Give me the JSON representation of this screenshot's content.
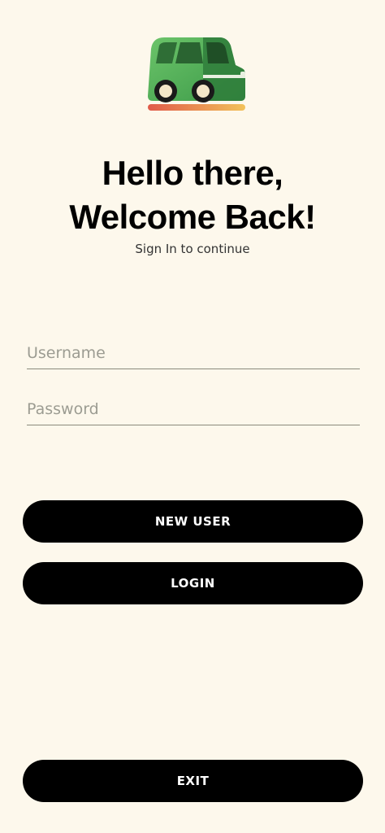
{
  "logo": {
    "icon": "car-icon",
    "colors": {
      "body_light": "#5fbf5f",
      "body_dark": "#2f7d3b",
      "road_left": "#e05a4a",
      "road_right": "#f2c25a"
    }
  },
  "header": {
    "title_line1": "Hello there,",
    "title_line2": "Welcome Back!",
    "subtitle": "Sign In to continue"
  },
  "form": {
    "username_placeholder": "Username",
    "password_placeholder": "Password"
  },
  "buttons": {
    "new_user": "NEW USER",
    "login": "LOGIN",
    "exit": "EXIT"
  },
  "colors": {
    "background": "#fdf8ec",
    "button": "#000000",
    "button_text": "#ffffff"
  }
}
